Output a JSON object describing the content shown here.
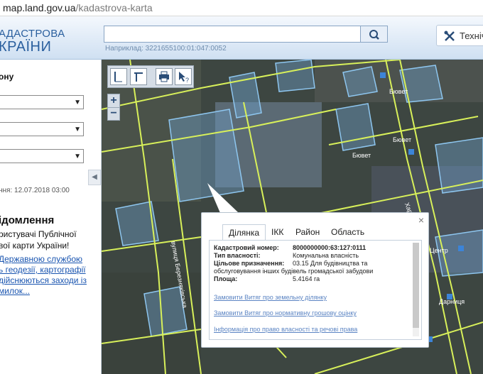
{
  "browser": {
    "host": "map.land.gov.ua",
    "path": "/kadastrova-karta"
  },
  "header": {
    "logo_line1": "АДАСТРОВА",
    "logo_line2": "КРАЇНИ",
    "search_placeholder": "",
    "search_example": "Наприклад: 3221655100:01:047:0052",
    "tech_label": "Технічн"
  },
  "sidebar": {
    "heading": "ону",
    "selects": [
      "",
      "",
      ""
    ],
    "updated": "ння: 12.07.2018 03:00",
    "notice_title": "ідомлення",
    "notice_lines": [
      "ристувачі Публічної",
      "вої карти України!"
    ],
    "notice_links": [
      "  Державною службою",
      "ь геодезії, картографії",
      "дійснюються заходи із",
      "милок..."
    ]
  },
  "map": {
    "labels": [
      "Бювет",
      "Бювет",
      "Бювет",
      "Харківське шосе",
      "вулиця Березняківська",
      "Дарниця",
      "Центр"
    ],
    "toolbar": [
      "ruler-icon",
      "area-ruler-icon",
      "print-icon",
      "info-cursor-icon"
    ],
    "zoom_in": "+",
    "zoom_out": "−"
  },
  "popup": {
    "tabs": [
      "Ділянка",
      "ІКК",
      "Район",
      "Область"
    ],
    "active_tab": "Ділянка",
    "fields": [
      {
        "label": "Кадастровий номер:",
        "value": "8000000000:63:127:0111"
      },
      {
        "label": "Тип власності:",
        "value": "Комунальна власність"
      },
      {
        "label": "Цільове призначення:",
        "value": "03.15 Для будівництва та"
      },
      {
        "label": "",
        "value": "обслуговування інших будівель громадської забудови"
      },
      {
        "label": "Площа:",
        "value": "5.4164 га"
      }
    ],
    "links": [
      "Замовити Витяг про земельну ділянку",
      "Замовити Витяг про нормативну грошову оцінку",
      "Інформація про право власності та речові права"
    ],
    "close": "×"
  }
}
